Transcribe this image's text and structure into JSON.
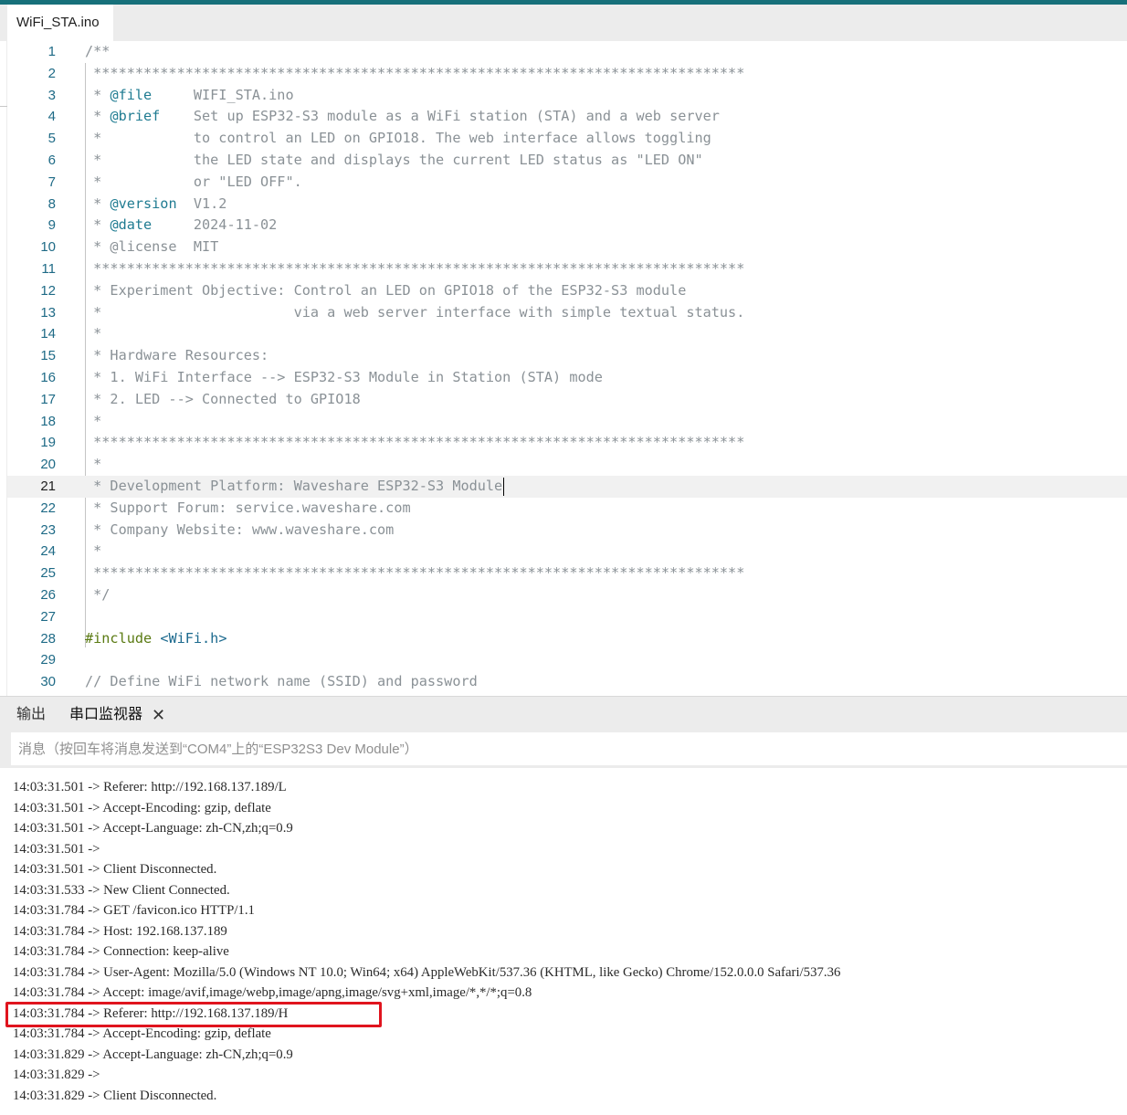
{
  "editor": {
    "file_tab": "WiFi_STA.ino",
    "active_line": 21,
    "lines": [
      {
        "n": "1",
        "segs": [
          {
            "t": "/**",
            "c": ""
          }
        ]
      },
      {
        "n": "2",
        "segs": [
          {
            "t": " ******************************************************************************",
            "c": ""
          }
        ]
      },
      {
        "n": "3",
        "segs": [
          {
            "t": " * ",
            "c": ""
          },
          {
            "t": "@file",
            "c": "kw"
          },
          {
            "t": "     WIFI_STA.ino",
            "c": ""
          }
        ]
      },
      {
        "n": "4",
        "segs": [
          {
            "t": " * ",
            "c": ""
          },
          {
            "t": "@brief",
            "c": "kw"
          },
          {
            "t": "    Set up ESP32-S3 module as a WiFi station (STA) and a web server",
            "c": ""
          }
        ]
      },
      {
        "n": "5",
        "segs": [
          {
            "t": " *           to control an LED on GPIO18. The web interface allows toggling",
            "c": ""
          }
        ]
      },
      {
        "n": "6",
        "segs": [
          {
            "t": " *           the LED state and displays the current LED status as \"LED ON\"",
            "c": ""
          }
        ]
      },
      {
        "n": "7",
        "segs": [
          {
            "t": " *           or \"LED OFF\".",
            "c": ""
          }
        ]
      },
      {
        "n": "8",
        "segs": [
          {
            "t": " * ",
            "c": ""
          },
          {
            "t": "@version",
            "c": "kw"
          },
          {
            "t": "  V1.2",
            "c": ""
          }
        ]
      },
      {
        "n": "9",
        "segs": [
          {
            "t": " * ",
            "c": ""
          },
          {
            "t": "@date",
            "c": "kw"
          },
          {
            "t": "     2024-11-02",
            "c": ""
          }
        ]
      },
      {
        "n": "10",
        "segs": [
          {
            "t": " * @license  MIT",
            "c": ""
          }
        ]
      },
      {
        "n": "11",
        "segs": [
          {
            "t": " ******************************************************************************",
            "c": ""
          }
        ]
      },
      {
        "n": "12",
        "segs": [
          {
            "t": " * Experiment Objective: Control an LED on GPIO18 of the ESP32-S3 module",
            "c": ""
          }
        ]
      },
      {
        "n": "13",
        "segs": [
          {
            "t": " *                       via a web server interface with simple textual status.",
            "c": ""
          }
        ]
      },
      {
        "n": "14",
        "segs": [
          {
            "t": " *",
            "c": ""
          }
        ]
      },
      {
        "n": "15",
        "segs": [
          {
            "t": " * Hardware Resources:",
            "c": ""
          }
        ]
      },
      {
        "n": "16",
        "segs": [
          {
            "t": " * 1. WiFi Interface --> ESP32-S3 Module in Station (STA) mode",
            "c": ""
          }
        ]
      },
      {
        "n": "17",
        "segs": [
          {
            "t": " * 2. LED --> Connected to GPIO18",
            "c": ""
          }
        ]
      },
      {
        "n": "18",
        "segs": [
          {
            "t": " *",
            "c": ""
          }
        ]
      },
      {
        "n": "19",
        "segs": [
          {
            "t": " ******************************************************************************",
            "c": ""
          }
        ]
      },
      {
        "n": "20",
        "segs": [
          {
            "t": " *",
            "c": ""
          }
        ]
      },
      {
        "n": "21",
        "segs": [
          {
            "t": " * Development Platform: Waveshare ESP32-S3 Module",
            "c": ""
          }
        ]
      },
      {
        "n": "22",
        "segs": [
          {
            "t": " * Support Forum: service.waveshare.com",
            "c": ""
          }
        ]
      },
      {
        "n": "23",
        "segs": [
          {
            "t": " * Company Website: www.waveshare.com",
            "c": ""
          }
        ]
      },
      {
        "n": "24",
        "segs": [
          {
            "t": " *",
            "c": ""
          }
        ]
      },
      {
        "n": "25",
        "segs": [
          {
            "t": " ******************************************************************************",
            "c": ""
          }
        ]
      },
      {
        "n": "26",
        "segs": [
          {
            "t": " */",
            "c": ""
          }
        ]
      },
      {
        "n": "27",
        "segs": [
          {
            "t": "",
            "c": ""
          }
        ]
      },
      {
        "n": "28",
        "segs": [
          {
            "t": "#include",
            "c": "dir"
          },
          {
            "t": " ",
            "c": ""
          },
          {
            "t": "<WiFi.h>",
            "c": "hdr"
          }
        ]
      },
      {
        "n": "29",
        "segs": [
          {
            "t": "",
            "c": ""
          }
        ]
      },
      {
        "n": "30",
        "segs": [
          {
            "t": "// Define WiFi network name (SSID) and password",
            "c": ""
          }
        ]
      }
    ]
  },
  "panel": {
    "tab_output": "输出",
    "tab_serial": "串口监视器",
    "close_glyph": "✕",
    "message_placeholder": "消息（按回车将消息发送到“COM4”上的“ESP32S3 Dev Module”）"
  },
  "serial": {
    "highlighted_index": 11,
    "lines": [
      "14:03:31.501 -> Referer: http://192.168.137.189/L",
      "14:03:31.501 -> Accept-Encoding: gzip, deflate",
      "14:03:31.501 -> Accept-Language: zh-CN,zh;q=0.9",
      "14:03:31.501 ->",
      "14:03:31.501 -> Client Disconnected.",
      "14:03:31.533 -> New Client Connected.",
      "14:03:31.784 -> GET /favicon.ico HTTP/1.1",
      "14:03:31.784 -> Host: 192.168.137.189",
      "14:03:31.784 -> Connection: keep-alive",
      "14:03:31.784 -> User-Agent: Mozilla/5.0 (Windows NT 10.0; Win64; x64) AppleWebKit/537.36 (KHTML, like Gecko) Chrome/152.0.0.0 Safari/537.36",
      "14:03:31.784 -> Accept: image/avif,image/webp,image/apng,image/svg+xml,image/*,*/*;q=0.8",
      "14:03:31.784 -> Referer: http://192.168.137.189/H",
      "14:03:31.784 -> Accept-Encoding: gzip, deflate",
      "14:03:31.829 -> Accept-Language: zh-CN,zh;q=0.9",
      "14:03:31.829 ->",
      "14:03:31.829 -> Client Disconnected."
    ]
  },
  "colors": {
    "accent_bar": "#17707a",
    "line_number": "#1e6a86",
    "comment": "#8a9196",
    "doc_tag": "#1f7b91",
    "highlight_box": "#e0141e"
  }
}
